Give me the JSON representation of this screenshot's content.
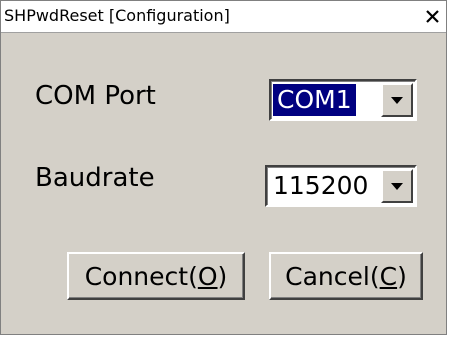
{
  "window": {
    "title": "SHPwdReset [Configuration]",
    "close_glyph": "X"
  },
  "com_port": {
    "label": "COM Port",
    "selected_value": "COM1"
  },
  "baudrate": {
    "label": "Baudrate",
    "selected_value": "115200"
  },
  "buttons": {
    "connect": {
      "label_prefix": "Connect(",
      "mnemonic": "O",
      "label_suffix": ")"
    },
    "cancel": {
      "label_prefix": "Cancel(",
      "mnemonic": "C",
      "label_suffix": ")"
    }
  },
  "colors": {
    "dialog_face": "#d4d0c8",
    "selection_bg": "#000080",
    "selection_text": "#ffffff"
  }
}
